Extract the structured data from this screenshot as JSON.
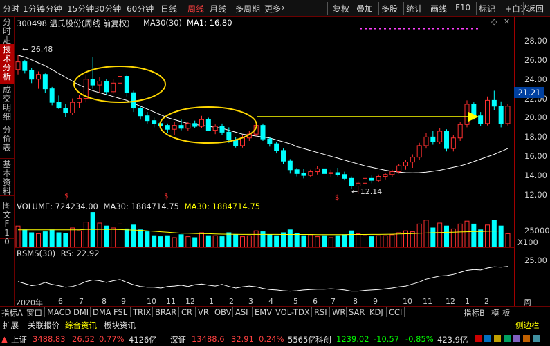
{
  "toolbar": {
    "left_items": [
      "分时",
      "1分钟",
      "5分钟",
      "15分钟",
      "30分钟",
      "60分钟",
      "日线",
      "周线",
      "月线",
      "多周期",
      "更多"
    ],
    "active": "周线",
    "more_arrow": "›",
    "right_items": [
      "复权",
      "叠加",
      "多股",
      "统计",
      "画线",
      "F10",
      "标记",
      "+自选",
      "返回"
    ]
  },
  "left_tabs": [
    {
      "label": "分时走势",
      "active": false
    },
    {
      "label": "技术分析",
      "active": true
    },
    {
      "label": "成交明细",
      "active": false
    },
    {
      "label": "分价表",
      "active": false
    },
    {
      "label": "基本资料",
      "active": false
    }
  ],
  "small_tabs": [
    "图文F10"
  ],
  "chart_header": {
    "stock": "300498 温氏股份(周线 前复权)",
    "ma_label": "MA30(30)",
    "ma1": "MA1: 16.80"
  },
  "price_axis": [
    "28.00",
    "26.00",
    "24.00",
    "22.00",
    "20.00",
    "18.00",
    "16.00",
    "14.00",
    "12.00"
  ],
  "current_price": "21.21",
  "annotations": {
    "high": "26.48",
    "low": "12.14",
    "dollar": "$"
  },
  "volume_header": {
    "volume": "VOLUME: 724234.00",
    "ma30": "MA30: 1884714.75",
    "ma30b": "MA30: 1884714.75"
  },
  "volume_axis": {
    "tick": "25000",
    "unit": "X100"
  },
  "rsms_header": {
    "label": "RSMS(30)",
    "value": "RS: 22.92"
  },
  "rsms_axis": {
    "tick": "25.00"
  },
  "x_axis": {
    "year": "2020年",
    "months": [
      "6",
      "7",
      "8",
      "9",
      "10",
      "11",
      "12",
      "1",
      "2",
      "3",
      "4",
      "5",
      "6",
      "7",
      "8",
      "9",
      "10",
      "11",
      "12",
      "1",
      "2"
    ],
    "right_label": "周线"
  },
  "indicator_tabs": [
    "指标A",
    "窗口",
    "MACD",
    "DMI",
    "DMA",
    "FSL",
    "TRIX",
    "BRAR",
    "CR",
    "VR",
    "OBV",
    "ASI",
    "EMV",
    "VOL-TDX",
    "RSI",
    "WR",
    "SAR",
    "KDJ",
    "CCI"
  ],
  "indicator_right": [
    "指标B",
    "模",
    "板"
  ],
  "info_tabs": [
    "扩展",
    "关联报价",
    "综合资讯",
    "板块资讯"
  ],
  "info_active": "综合资讯",
  "info_right": "侧边栏",
  "status": {
    "sh_name": "上证",
    "sh_val": "3488.83",
    "sh_chg": "26.52",
    "sh_pct": "0.77%",
    "sh_amt": "4126亿",
    "sz_name": "深证",
    "sz_val": "13488.6",
    "sz_chg": "32.91",
    "sz_pct": "0.24%",
    "sz_amt": "5565亿",
    "kc_name": "科创",
    "kc_val": "1239.02",
    "kc_chg": "-10.57",
    "kc_pct": "-0.85%",
    "kc_amt": "423.9亿"
  },
  "colors": {
    "up": "#ff3030",
    "down": "#00ffff",
    "ma": "#ffffff",
    "ellipse": "#ffd700",
    "arrow": "#ffff00",
    "volume_ma": "#ffff00"
  },
  "chart_data": [
    {
      "type": "candlestick",
      "title": "300498 温氏股份(周线 前复权)",
      "ylim": [
        11.5,
        29.0
      ],
      "bars": [
        {
          "o": 25.0,
          "h": 26.5,
          "l": 24.5,
          "c": 25.8
        },
        {
          "o": 25.8,
          "h": 26.0,
          "l": 24.6,
          "c": 24.9
        },
        {
          "o": 24.9,
          "h": 25.2,
          "l": 23.6,
          "c": 24.0
        },
        {
          "o": 24.0,
          "h": 24.8,
          "l": 23.0,
          "c": 24.5
        },
        {
          "o": 24.5,
          "h": 24.6,
          "l": 22.6,
          "c": 23.0
        },
        {
          "o": 23.0,
          "h": 23.2,
          "l": 21.3,
          "c": 21.6
        },
        {
          "o": 21.6,
          "h": 22.3,
          "l": 20.9,
          "c": 21.0
        },
        {
          "o": 21.0,
          "h": 21.4,
          "l": 20.1,
          "c": 20.5
        },
        {
          "o": 20.5,
          "h": 22.0,
          "l": 20.3,
          "c": 21.6
        },
        {
          "o": 21.6,
          "h": 22.4,
          "l": 21.0,
          "c": 22.0
        },
        {
          "o": 22.0,
          "h": 24.5,
          "l": 21.6,
          "c": 24.0
        },
        {
          "o": 24.0,
          "h": 26.3,
          "l": 23.0,
          "c": 23.4
        },
        {
          "o": 23.4,
          "h": 24.2,
          "l": 22.6,
          "c": 23.8
        },
        {
          "o": 23.8,
          "h": 24.0,
          "l": 22.4,
          "c": 22.7
        },
        {
          "o": 22.7,
          "h": 24.0,
          "l": 22.5,
          "c": 23.6
        },
        {
          "o": 23.6,
          "h": 24.6,
          "l": 23.2,
          "c": 24.3
        },
        {
          "o": 24.3,
          "h": 24.5,
          "l": 22.2,
          "c": 22.6
        },
        {
          "o": 22.6,
          "h": 22.8,
          "l": 20.6,
          "c": 21.0
        },
        {
          "o": 21.0,
          "h": 21.2,
          "l": 19.8,
          "c": 20.2
        },
        {
          "o": 20.2,
          "h": 20.6,
          "l": 19.4,
          "c": 19.7
        },
        {
          "o": 19.7,
          "h": 20.0,
          "l": 19.0,
          "c": 19.4
        },
        {
          "o": 19.4,
          "h": 19.6,
          "l": 18.8,
          "c": 19.2
        },
        {
          "o": 19.2,
          "h": 19.4,
          "l": 18.4,
          "c": 18.8
        },
        {
          "o": 18.8,
          "h": 19.6,
          "l": 18.2,
          "c": 19.2
        },
        {
          "o": 19.2,
          "h": 19.8,
          "l": 18.7,
          "c": 18.9
        },
        {
          "o": 18.9,
          "h": 19.6,
          "l": 18.6,
          "c": 19.4
        },
        {
          "o": 19.4,
          "h": 19.7,
          "l": 18.9,
          "c": 19.1
        },
        {
          "o": 19.1,
          "h": 20.2,
          "l": 18.9,
          "c": 19.8
        },
        {
          "o": 19.8,
          "h": 20.0,
          "l": 18.6,
          "c": 18.7
        },
        {
          "o": 18.7,
          "h": 19.3,
          "l": 18.3,
          "c": 19.1
        },
        {
          "o": 19.1,
          "h": 19.4,
          "l": 18.2,
          "c": 18.5
        },
        {
          "o": 18.5,
          "h": 19.0,
          "l": 17.4,
          "c": 17.7
        },
        {
          "o": 17.7,
          "h": 18.0,
          "l": 16.9,
          "c": 17.1
        },
        {
          "o": 17.1,
          "h": 18.2,
          "l": 16.9,
          "c": 17.9
        },
        {
          "o": 17.9,
          "h": 18.6,
          "l": 17.6,
          "c": 18.3
        },
        {
          "o": 18.3,
          "h": 19.6,
          "l": 18.1,
          "c": 19.2
        },
        {
          "o": 19.2,
          "h": 19.4,
          "l": 17.6,
          "c": 17.8
        },
        {
          "o": 17.8,
          "h": 18.0,
          "l": 17.0,
          "c": 17.3
        },
        {
          "o": 17.3,
          "h": 17.5,
          "l": 16.3,
          "c": 16.6
        },
        {
          "o": 16.6,
          "h": 16.8,
          "l": 15.2,
          "c": 15.5
        },
        {
          "o": 15.5,
          "h": 15.7,
          "l": 14.2,
          "c": 14.6
        },
        {
          "o": 14.6,
          "h": 14.8,
          "l": 13.9,
          "c": 14.2
        },
        {
          "o": 14.2,
          "h": 14.7,
          "l": 13.7,
          "c": 14.0
        },
        {
          "o": 14.0,
          "h": 14.6,
          "l": 13.8,
          "c": 14.4
        },
        {
          "o": 14.4,
          "h": 15.0,
          "l": 14.1,
          "c": 14.7
        },
        {
          "o": 14.7,
          "h": 14.9,
          "l": 14.0,
          "c": 14.2
        },
        {
          "o": 14.2,
          "h": 14.6,
          "l": 13.8,
          "c": 14.3
        },
        {
          "o": 14.3,
          "h": 14.8,
          "l": 13.9,
          "c": 14.1
        },
        {
          "o": 14.1,
          "h": 14.4,
          "l": 13.5,
          "c": 13.7
        },
        {
          "o": 13.7,
          "h": 13.9,
          "l": 12.6,
          "c": 12.9
        },
        {
          "o": 12.9,
          "h": 13.4,
          "l": 12.1,
          "c": 13.2
        },
        {
          "o": 13.2,
          "h": 13.9,
          "l": 13.0,
          "c": 13.7
        },
        {
          "o": 13.7,
          "h": 14.0,
          "l": 13.2,
          "c": 13.5
        },
        {
          "o": 13.5,
          "h": 14.1,
          "l": 13.3,
          "c": 13.9
        },
        {
          "o": 13.9,
          "h": 14.3,
          "l": 13.6,
          "c": 14.1
        },
        {
          "o": 14.1,
          "h": 14.6,
          "l": 13.8,
          "c": 14.4
        },
        {
          "o": 14.4,
          "h": 15.2,
          "l": 14.2,
          "c": 15.0
        },
        {
          "o": 15.0,
          "h": 15.6,
          "l": 14.6,
          "c": 15.4
        },
        {
          "o": 15.4,
          "h": 16.2,
          "l": 14.8,
          "c": 15.9
        },
        {
          "o": 15.9,
          "h": 17.4,
          "l": 15.6,
          "c": 17.1
        },
        {
          "o": 17.1,
          "h": 18.4,
          "l": 16.8,
          "c": 18.0
        },
        {
          "o": 18.0,
          "h": 18.6,
          "l": 17.2,
          "c": 17.5
        },
        {
          "o": 17.5,
          "h": 18.9,
          "l": 17.3,
          "c": 18.6
        },
        {
          "o": 18.6,
          "h": 18.8,
          "l": 16.5,
          "c": 16.8
        },
        {
          "o": 16.8,
          "h": 18.2,
          "l": 16.5,
          "c": 17.9
        },
        {
          "o": 17.9,
          "h": 19.6,
          "l": 17.6,
          "c": 19.3
        },
        {
          "o": 19.3,
          "h": 21.8,
          "l": 19.0,
          "c": 21.4
        },
        {
          "o": 21.4,
          "h": 21.6,
          "l": 19.8,
          "c": 20.2
        },
        {
          "o": 20.2,
          "h": 20.6,
          "l": 19.1,
          "c": 19.4
        },
        {
          "o": 19.4,
          "h": 22.2,
          "l": 19.2,
          "c": 21.8
        },
        {
          "o": 21.8,
          "h": 22.8,
          "l": 20.8,
          "c": 21.2
        },
        {
          "o": 21.2,
          "h": 21.7,
          "l": 19.0,
          "c": 19.4
        },
        {
          "o": 19.4,
          "h": 21.4,
          "l": 19.2,
          "c": 21.2
        }
      ],
      "ma30": [
        26.5,
        26.3,
        26.0,
        25.7,
        25.4,
        25.0,
        24.6,
        24.2,
        23.8,
        23.4,
        23.1,
        22.8,
        22.6,
        22.4,
        22.2,
        22.0,
        21.8,
        21.5,
        21.2,
        20.9,
        20.6,
        20.3,
        20.0,
        19.8,
        19.6,
        19.4,
        19.3,
        19.2,
        19.1,
        19.0,
        18.9,
        18.7,
        18.5,
        18.3,
        18.2,
        18.1,
        18.0,
        17.9,
        17.7,
        17.5,
        17.3,
        17.0,
        16.8,
        16.6,
        16.4,
        16.2,
        16.0,
        15.8,
        15.6,
        15.4,
        15.2,
        15.0,
        14.85,
        14.7,
        14.55,
        14.45,
        14.35,
        14.3,
        14.28,
        14.3,
        14.35,
        14.45,
        14.55,
        14.7,
        14.85,
        15.0,
        15.2,
        15.45,
        15.7,
        15.95,
        16.2,
        16.5,
        16.8
      ],
      "volume": [
        22,
        18,
        15,
        14,
        16,
        18,
        15,
        14,
        20,
        17,
        26,
        36,
        25,
        22,
        20,
        24,
        19,
        23,
        18,
        16,
        12,
        11,
        12,
        10,
        13,
        11,
        10,
        15,
        12,
        12,
        11,
        15,
        13,
        11,
        12,
        17,
        16,
        13,
        12,
        15,
        18,
        14,
        12,
        13,
        11,
        12,
        10,
        12,
        13,
        17,
        14,
        12,
        11,
        12,
        12,
        13,
        15,
        17,
        16,
        24,
        28,
        20,
        25,
        22,
        19,
        24,
        27,
        24,
        18,
        23,
        28,
        22,
        14
      ],
      "volume_ma": [
        18,
        18,
        18,
        18,
        18,
        18,
        18,
        18,
        18,
        18,
        18.5,
        18.5,
        18.5,
        18.5,
        18.5,
        18.3,
        18,
        17.8,
        17.5,
        17,
        16.5,
        16,
        15.5,
        15,
        14.6,
        14.4,
        14.2,
        14,
        14,
        13.8,
        13.6,
        13.5,
        13.4,
        13.3,
        13.3,
        13.3,
        13.3,
        13.3,
        13.3,
        13.2,
        13.2,
        13.2,
        13.2,
        13.2,
        13.1,
        13.1,
        13.1,
        13.1,
        13.1,
        13.2,
        13.2,
        13.2,
        13.3,
        13.3,
        13.4,
        13.5,
        13.7,
        13.9,
        14.1,
        14.4,
        14.7,
        15,
        15.2,
        15.4,
        15.6,
        15.8,
        16,
        16.2,
        16.3,
        16.5,
        16.7,
        16.8,
        16.8
      ],
      "rsms": [
        20,
        19.5,
        19,
        19.2,
        19.8,
        19.3,
        19,
        18.6,
        18.8,
        19.3,
        20,
        20.4,
        20.2,
        19.8,
        20.2,
        20.5,
        19.8,
        19.2,
        18.8,
        18.6,
        18.6,
        18.4,
        18.8,
        18.9,
        19.1,
        18.8,
        19.2,
        19.4,
        19.1,
        18.9,
        19.3,
        18.8,
        18.4,
        18.7,
        18.9,
        18.7,
        18.3,
        18.0,
        17.9,
        17.7,
        17.6,
        17.7,
        17.9,
        18.0,
        18.1,
        18.1,
        18.2,
        18.1,
        17.9,
        17.6,
        17.6,
        17.8,
        17.9,
        18.0,
        18.2,
        18.4,
        18.7,
        18.9,
        19.4,
        19.9,
        20.6,
        21.0,
        21.4,
        21.5,
        21.8,
        22.3,
        22.8,
        23.0,
        22.9,
        23.4,
        23.7,
        23.6,
        23.8
      ],
      "rsms_ylim": [
        16.5,
        26.5
      ]
    }
  ]
}
